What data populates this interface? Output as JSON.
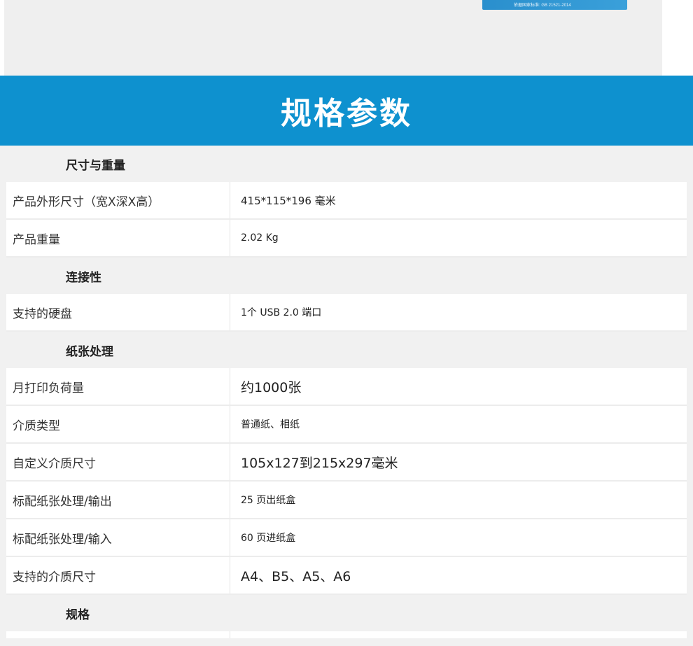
{
  "top_image": {
    "text": "依据国家标准: GB 21521-2014"
  },
  "banner": {
    "title": "规格参数"
  },
  "sections": [
    {
      "header": "尺寸与重量",
      "rows": [
        {
          "label": "产品外形尺寸（宽X深X高）",
          "value": "415*115*196  毫米"
        },
        {
          "label": "产品重量",
          "value": "2.02 Kg"
        }
      ]
    },
    {
      "header": "连接性",
      "rows": [
        {
          "label": "支持的硬盘",
          "value": "1个 USB 2.0 端口"
        }
      ]
    },
    {
      "header": "纸张处理",
      "rows": [
        {
          "label": "月打印负荷量",
          "value": "约1000张"
        },
        {
          "label": "介质类型",
          "value": "普通纸、相纸"
        },
        {
          "label": "自定义介质尺寸",
          "value": "105x127到215x297毫米"
        },
        {
          "label": "标配纸张处理/输出",
          "value": "25 页出纸盒"
        },
        {
          "label": "标配纸张处理/输入",
          "value": "60 页进纸盒"
        },
        {
          "label": "支持的介质尺寸",
          "value": "A4、B5、A5、A6"
        }
      ]
    },
    {
      "header": "规格",
      "rows": []
    }
  ]
}
